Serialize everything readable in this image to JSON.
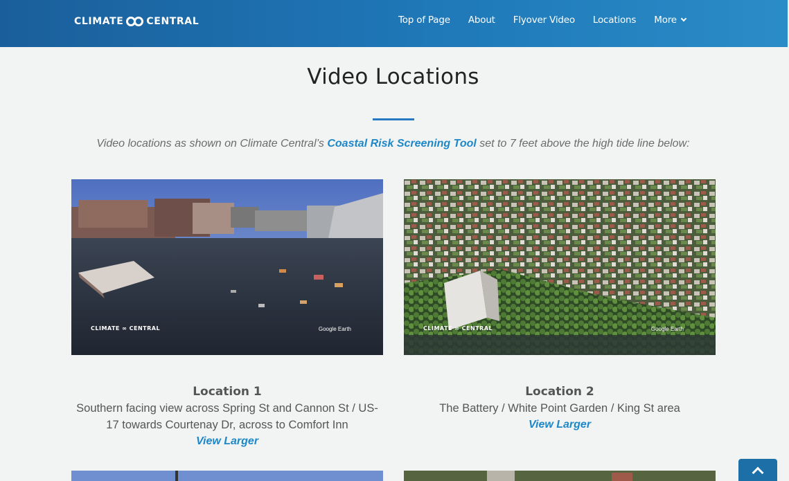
{
  "header": {
    "logo_left": "CLIMATE",
    "logo_right": "CENTRAL",
    "nav": [
      "Top of Page",
      "About",
      "Flyover Video",
      "Locations",
      "More"
    ]
  },
  "main": {
    "title": "Video Locations",
    "intro_before": "Video locations as shown on Climate Central’s ",
    "intro_link": "Coastal Risk Screening Tool",
    "intro_after": " set to 7 feet above the high tide line below:"
  },
  "locations": [
    {
      "title": "Location 1",
      "description": "Southern facing view across Spring St and Cannon St / US-17 towards Courtenay Dr, across to Comfort Inn",
      "link": "View Larger",
      "watermark_left": "CLIMATE ∞ CENTRAL",
      "watermark_right": "Google Earth"
    },
    {
      "title": "Location 2",
      "description": "The Battery / White Point Garden / King St area",
      "link": "View Larger",
      "watermark_left": "CLIMATE ∞ CENTRAL",
      "watermark_right": "Google Earth"
    }
  ],
  "colors": {
    "header_start": "#1a5f9b",
    "header_end": "#2a8cc7",
    "accent": "#2579c2",
    "link": "#1d87c8",
    "background": "#f2f3f3"
  },
  "icons": {
    "more": "chevron-down-icon",
    "back_to_top": "chevron-up-icon"
  }
}
